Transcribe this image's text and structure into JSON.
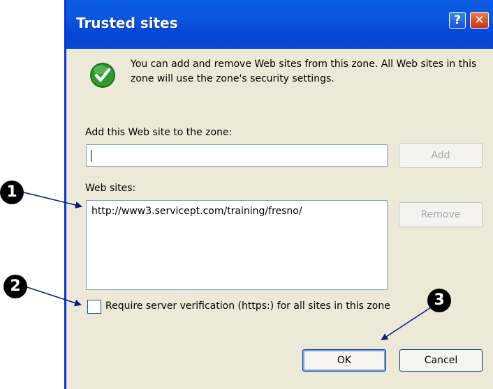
{
  "dialog": {
    "title": "Trusted sites",
    "help_glyph": "?",
    "close_glyph": "✕",
    "message": "You can add and remove Web sites from this zone. All Web sites in this zone will use the zone's security settings.",
    "add_label": "Add this Web site to the zone:",
    "add_input_value": "",
    "add_button": "Add",
    "sites_label": "Web sites:",
    "sites": [
      "http://www3.servicept.com/training/fresno/"
    ],
    "remove_button": "Remove",
    "require_https_label": "Require server verification (https:) for all sites in this zone",
    "require_https_checked": false,
    "ok_button": "OK",
    "cancel_button": "Cancel"
  },
  "callouts": [
    "1",
    "2",
    "3"
  ],
  "icons": {
    "zone": "green-check-icon",
    "help": "help-icon",
    "close": "close-icon"
  },
  "colors": {
    "titlebar": "#0a5ce0",
    "dialog_bg": "#ece9d8",
    "check_green": "#2e9a2a",
    "close_red": "#d45a2e",
    "arrow": "#0a1a7a"
  }
}
